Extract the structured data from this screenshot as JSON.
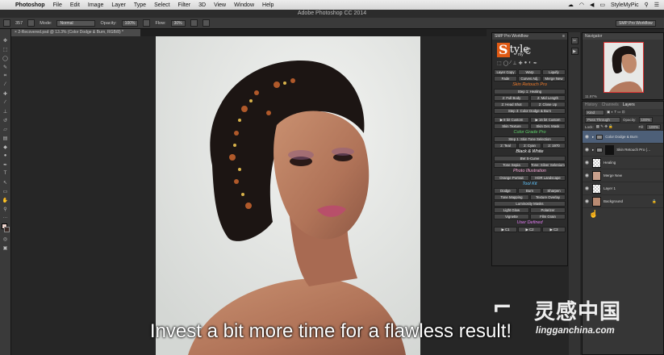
{
  "menubar": {
    "app_name": "Photoshop",
    "items": [
      "File",
      "Edit",
      "Image",
      "Layer",
      "Type",
      "Select",
      "Filter",
      "3D",
      "View",
      "Window",
      "Help"
    ],
    "user": "StyleMyPic"
  },
  "window": {
    "title": "Adobe Photoshop CC 2014"
  },
  "options": {
    "brush_size": "357",
    "mode_label": "Mode:",
    "mode_value": "Normal",
    "opacity_label": "Opacity:",
    "opacity_value": "100%",
    "flow_label": "Flow:",
    "flow_value": "30%"
  },
  "workspace_select": "SMP Pro Workflow",
  "document_tab": "2-Recovered.psd @ 13.3% (Color Dodge & Burn, RGB/8) *",
  "smp": {
    "title": "SMP Pro Workflow",
    "logo_s": "S",
    "logo_tyle": "tyle",
    "logo_c": "c",
    "logo_my": "my",
    "row1": [
      "Layer Copy",
      "Warp",
      "Liquify"
    ],
    "row2": [
      "Fade",
      "Curves Adj.",
      "Merge New"
    ],
    "sec_skin": "Skin Retouch Pro",
    "step1": "Step 1: Healing",
    "row3": [
      "2: Full Body",
      "2: Mid Length"
    ],
    "row4": [
      "2: Head Shot",
      "2: Close Up"
    ],
    "step3": "Step 3: Color Dodge & Burn",
    "row5": [
      "▶ 8 bit Custom",
      "▶ 16 bit Custom"
    ],
    "row6": [
      "Skin Texture",
      "Skin Det. Mask"
    ],
    "sec_color": "Color Grade Pro",
    "step1b": "Step 1: Skin Tone Selection",
    "row7": [
      "2: Teal",
      "2: Cyan",
      "2: 1970"
    ],
    "sec_bw": "Black & White",
    "bw": "BW S-Curve",
    "row8": [
      "Tone Sepia",
      "Tone: Silver Selenium"
    ],
    "sec_photo": "Photo Illustration",
    "row9": [
      "Orange Portrait",
      "HDR Landscape"
    ],
    "sec_tool": "Tool Kit",
    "row10": [
      "Dodge",
      "Burn",
      "Sharpen"
    ],
    "row11": [
      "Tone Mapping",
      "Texture Overlay"
    ],
    "lum": "Luminosity Masks",
    "row12": [
      "Light Glow",
      "Polarizer"
    ],
    "row13": [
      "Vignette",
      "Film Grain"
    ],
    "sec_user": "User Defined",
    "row14": [
      "▶ C1",
      "▶ C2",
      "▶ C3"
    ]
  },
  "section_colors": {
    "skin": "#f07b2b",
    "color": "#5fd06a",
    "bw": "#ffffff",
    "photo": "#f7a9d8",
    "tool": "#62c6ff",
    "user": "#e07cf2"
  },
  "navigator": {
    "title": "Navigator",
    "zoom": "11.97%"
  },
  "layers_panel": {
    "tabs": [
      "History",
      "Channels",
      "Layers"
    ],
    "kind_label": "Kind",
    "blend": "Pass Through",
    "opacity_label": "Opacity:",
    "opacity": "100%",
    "lock_label": "Lock:",
    "fill_label": "Fill:",
    "fill": "100%",
    "layers": [
      {
        "name": "Color Dodge & Burn",
        "type": "folder",
        "selected": true
      },
      {
        "name": "Skin Retouch Pro (…",
        "type": "folder",
        "selected": false
      },
      {
        "name": "Healing",
        "type": "layer",
        "selected": false
      },
      {
        "name": "Merge New",
        "type": "layer",
        "selected": false
      },
      {
        "name": "Layer 1",
        "type": "layer",
        "selected": false
      },
      {
        "name": "Background",
        "type": "layer",
        "selected": false
      }
    ]
  },
  "caption": "Invest a bit more time for a flawless result!",
  "watermark": {
    "cn": "灵感中国",
    "url": "lingganchina.com"
  }
}
